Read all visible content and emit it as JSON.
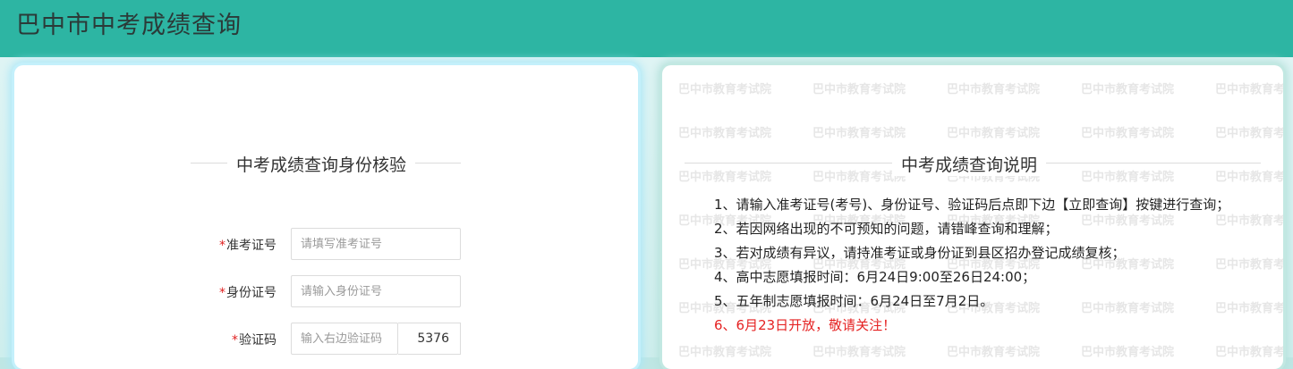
{
  "header": {
    "title": "巴中市中考成绩查询"
  },
  "form": {
    "title": "中考成绩查询身份核验",
    "fields": [
      {
        "required_mark": "*",
        "label": "准考证号",
        "placeholder": "请填写准考证号"
      },
      {
        "required_mark": "*",
        "label": "身份证号",
        "placeholder": "请输入身份证号"
      },
      {
        "required_mark": "*",
        "label": "验证码",
        "placeholder": "输入右边验证码"
      }
    ],
    "captcha_code": "5376"
  },
  "notice": {
    "title": "中考成绩查询说明",
    "watermark": "巴中市教育考试院",
    "items": [
      "1、请输入准考证号(考号)、身份证号、验证码后点即下边【立即查询】按键进行查询；",
      "2、若因网络出现的不可预知的问题，请错峰查询和理解；",
      "3、若对成绩有异议，请持准考证或身份证到县区招办登记成绩复核；",
      "4、高中志愿填报时间：6月24日9:00至26日24:00；",
      "5、五年制志愿填报时间：6月24日至7月2日。",
      "6、6月23日开放，敬请关注！"
    ]
  },
  "colors": {
    "header_bg": "#2db5a3",
    "required_mark": "#e02020",
    "highlight_text": "#e52222"
  }
}
